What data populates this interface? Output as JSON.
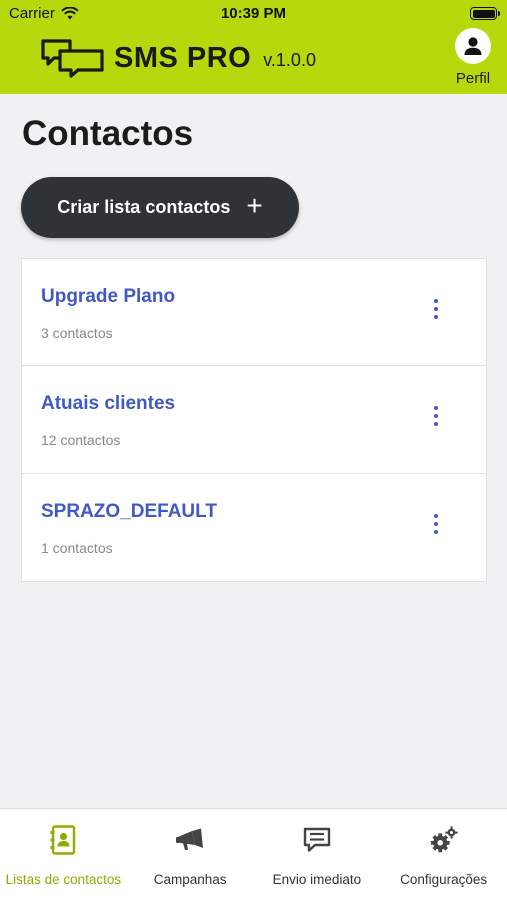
{
  "status_bar": {
    "carrier": "Carrier",
    "time": "10:39 PM"
  },
  "brand": {
    "name": "SMS PRO",
    "version": "v.1.0.0"
  },
  "profile": {
    "label": "Perfil"
  },
  "page": {
    "title": "Contactos"
  },
  "create_button": {
    "label": "Criar lista contactos"
  },
  "contact_lists": [
    {
      "title": "Upgrade Plano",
      "count": "3 contactos"
    },
    {
      "title": "Atuais clientes",
      "count": "12 contactos"
    },
    {
      "title": "SPRAZO_DEFAULT",
      "count": "1 contactos"
    }
  ],
  "tabs": [
    {
      "label": "Listas de contactos",
      "icon": "contacts-book-icon",
      "active": true
    },
    {
      "label": "Campanhas",
      "icon": "megaphone-icon",
      "active": false
    },
    {
      "label": "Envio imediato",
      "icon": "message-icon",
      "active": false
    },
    {
      "label": "Configurações",
      "icon": "gears-icon",
      "active": false
    }
  ],
  "colors": {
    "header": "#b7d80d",
    "accent": "#4158c6",
    "active_tab": "#8bb000",
    "button": "#2f3237"
  }
}
